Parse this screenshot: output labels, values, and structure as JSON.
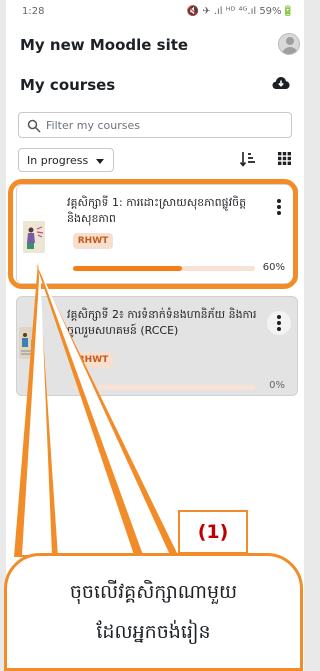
{
  "status_bar": {
    "time": "1:28",
    "indicators": "🔇 ✈ .ıl ᴴᴰ ⁴ᴳ.ıl 59%🔋"
  },
  "header": {
    "site_title": "My new Moodle site",
    "avatar_icon": "user-avatar-icon"
  },
  "courses": {
    "heading": "My courses",
    "download_icon": "cloud-download-icon",
    "search_placeholder": "Filter my courses",
    "filter_label": "In progress",
    "sort_icon": "sort-icon",
    "view_icon": "grid-view-icon",
    "items": [
      {
        "title": "វគ្គសិក្សាទី 1: ការដោះស្រាយសុខភាពផ្លូវចិត្ត និងសុខភាព",
        "badge": "RHWT",
        "progress_label": "60%",
        "progress": 0.6
      },
      {
        "title": "វគ្គសិក្សាទី 2៖ ការទំនាក់ទំនងហានិភ័យ និងការចូលរួមសហគមន៍ (RCCE)",
        "badge": "RHWT",
        "progress_label": "0%",
        "progress": 0
      }
    ]
  },
  "annotation": {
    "step": "(1)",
    "line1": "ចុចលើវគ្គសិក្សាណាមួយ",
    "line2": "ដែលអ្នកចង់រៀន"
  },
  "colors": {
    "accent": "#f28c28",
    "progress": "#f57f17",
    "step_text": "#c00000"
  }
}
